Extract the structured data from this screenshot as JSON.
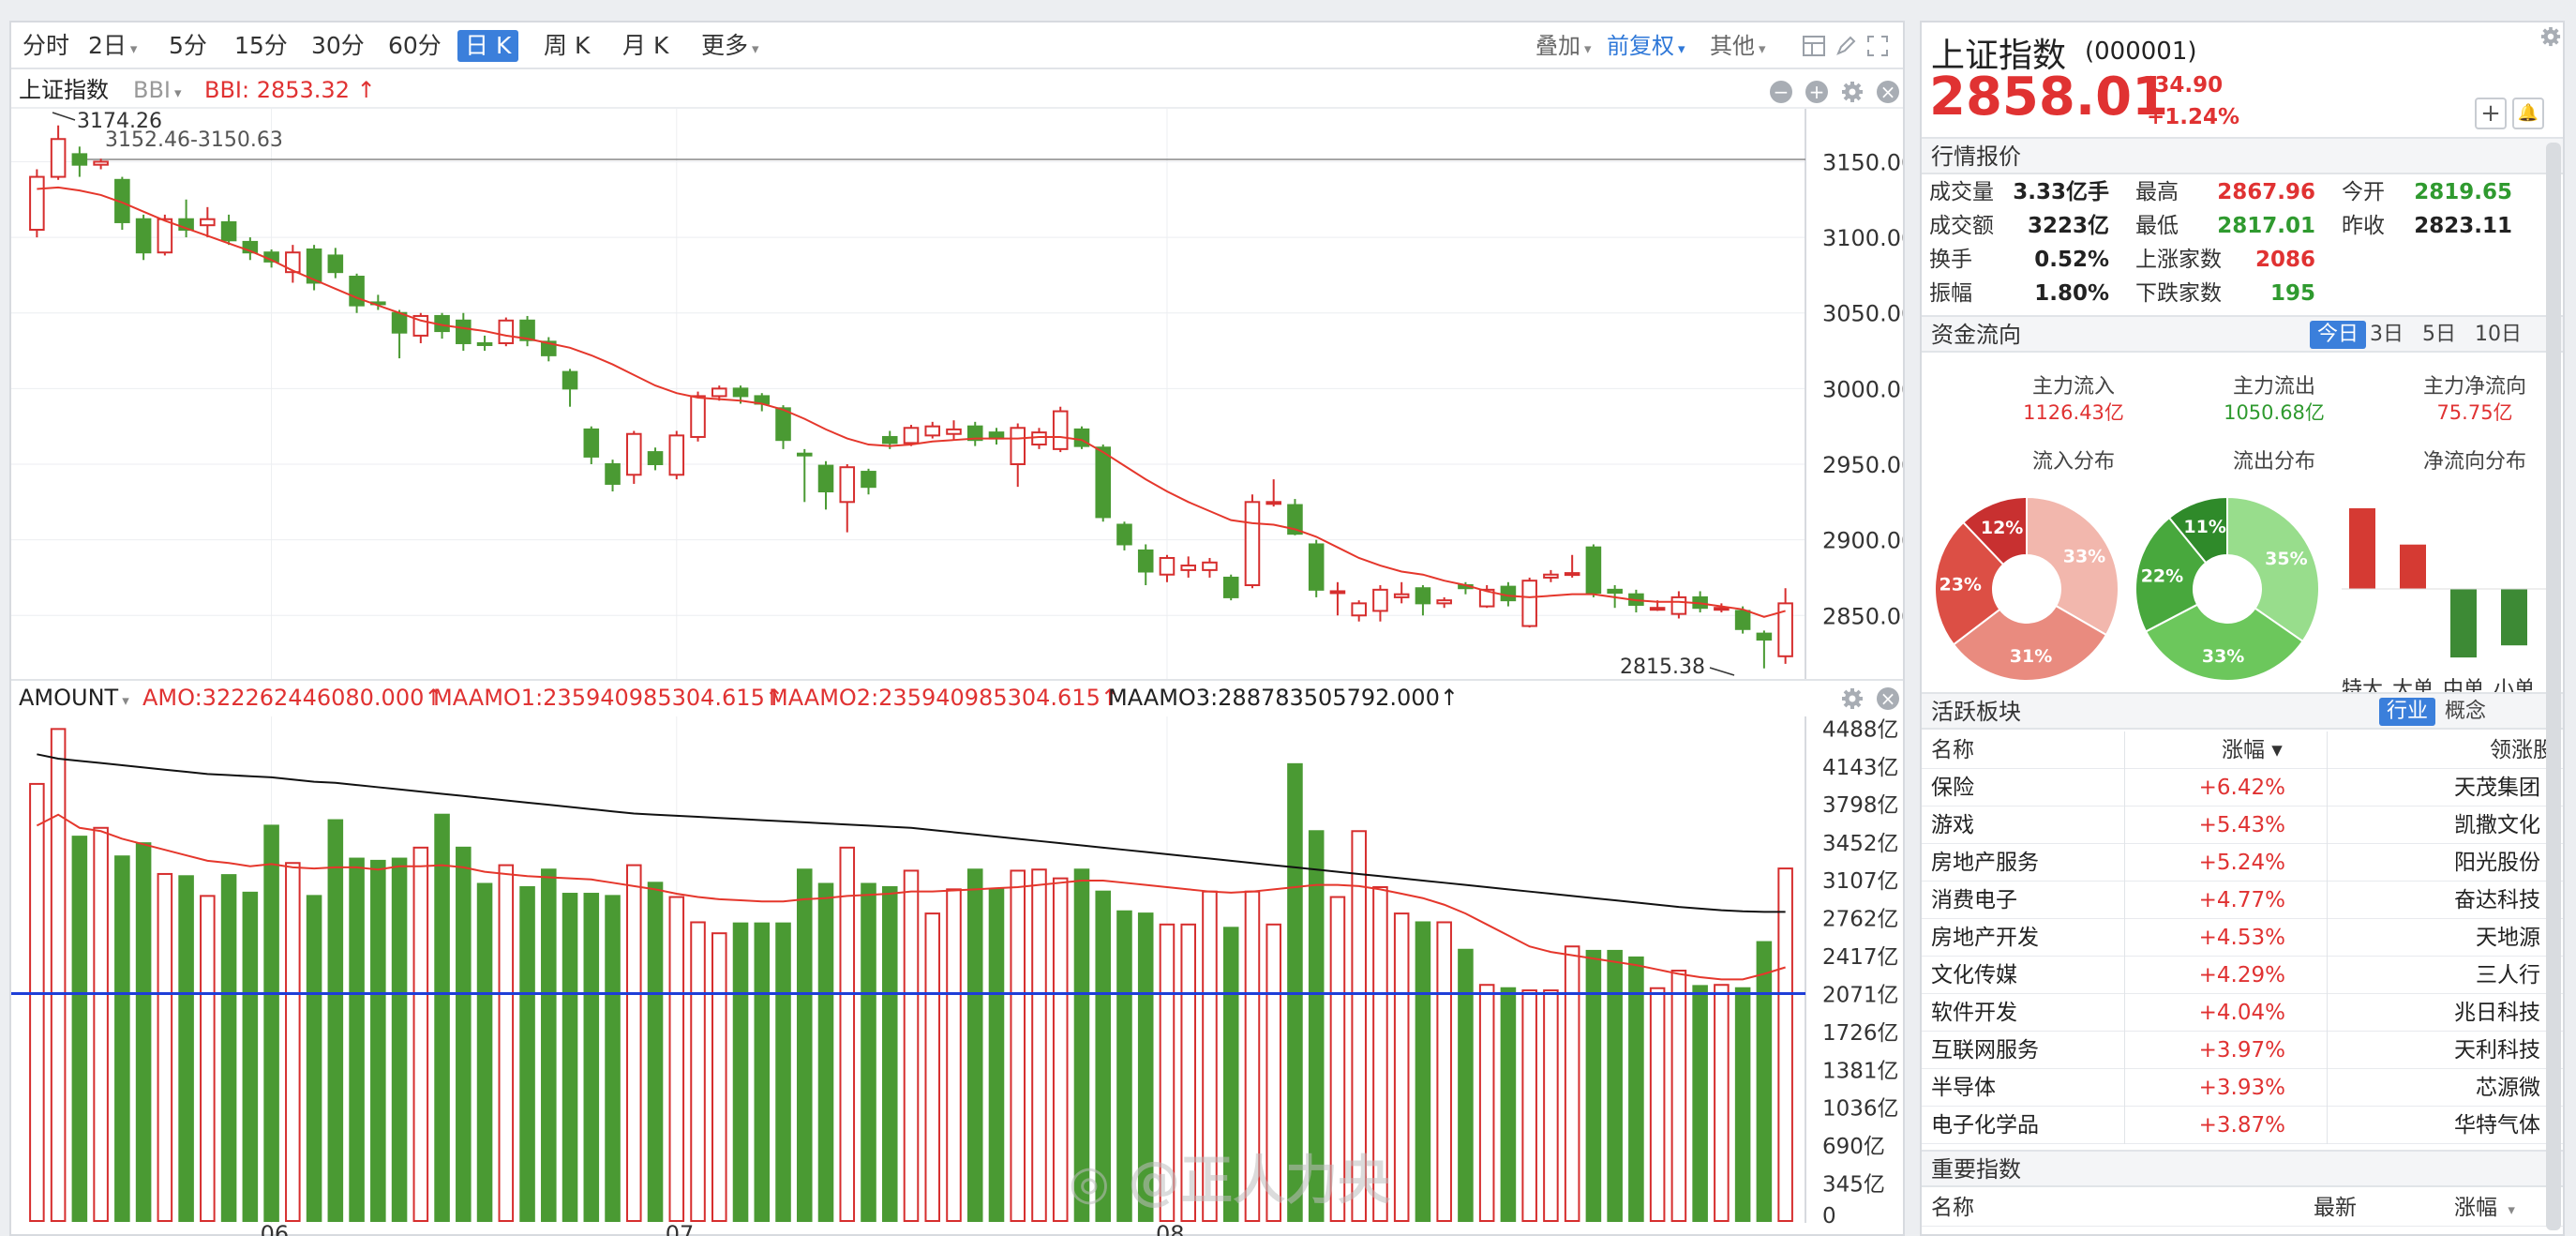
{
  "period_tabs": [
    {
      "label": "分时",
      "active": false,
      "caret": false
    },
    {
      "label": "2日",
      "active": false,
      "caret": true
    },
    {
      "label": "5分",
      "active": false,
      "caret": false
    },
    {
      "label": "15分",
      "active": false,
      "caret": false
    },
    {
      "label": "30分",
      "active": false,
      "caret": false
    },
    {
      "label": "60分",
      "active": false,
      "caret": false
    },
    {
      "label": "日 K",
      "active": true,
      "caret": false
    },
    {
      "label": "周 K",
      "active": false,
      "caret": false
    },
    {
      "label": "月 K",
      "active": false,
      "caret": false
    },
    {
      "label": "更多",
      "active": false,
      "caret": true
    }
  ],
  "toolbar_right": {
    "overlay": "叠加",
    "adjust": "前复权",
    "other": "其他"
  },
  "kline_header": {
    "name": "上证指数",
    "indicator": "BBI",
    "bbi_value": "BBI: 2853.32 ↑"
  },
  "volume_header": {
    "name": "AMOUNT",
    "amo": "AMO:322262446080.000↑",
    "ma1": "MAAMO1:235940985304.615↑",
    "ma2": "MAAMO2:235940985304.615↑",
    "ma3": "MAAMO3:288783505792.000↑"
  },
  "chart_data": {
    "type": "candlestick",
    "price_ylim": [
      2808,
      3185
    ],
    "price_ticks": [
      "3150.00",
      "3100.00",
      "3050.00",
      "3000.00",
      "2950.00",
      "2900.00",
      "2850.00"
    ],
    "price_tick_values": [
      3150,
      3100,
      3050,
      3000,
      2950,
      2900,
      2850
    ],
    "reference_line_value": 3151.5,
    "annotations": {
      "high": "3174.26",
      "range": "3152.46-3150.63",
      "low": "2815.38"
    },
    "x_labels": [
      "06",
      "07",
      "08"
    ],
    "x_label_index": [
      11,
      30,
      53
    ],
    "up_color": "#d62e2e",
    "down_color": "#4a9a33",
    "candles": [
      [
        3105,
        3140,
        3100,
        3145
      ],
      [
        3140,
        3165,
        3138,
        3174
      ],
      [
        3155,
        3148,
        3140,
        3160
      ],
      [
        3148,
        3150,
        3145,
        3152
      ],
      [
        3138,
        3110,
        3105,
        3140
      ],
      [
        3112,
        3090,
        3085,
        3115
      ],
      [
        3090,
        3112,
        3088,
        3115
      ],
      [
        3112,
        3105,
        3100,
        3125
      ],
      [
        3108,
        3112,
        3100,
        3120
      ],
      [
        3110,
        3098,
        3095,
        3115
      ],
      [
        3097,
        3090,
        3085,
        3100
      ],
      [
        3090,
        3084,
        3080,
        3092
      ],
      [
        3077,
        3090,
        3070,
        3095
      ],
      [
        3092,
        3070,
        3065,
        3095
      ],
      [
        3088,
        3077,
        3073,
        3093
      ],
      [
        3074,
        3055,
        3050,
        3076
      ],
      [
        3057,
        3056,
        3052,
        3062
      ],
      [
        3050,
        3037,
        3020,
        3052
      ],
      [
        3035,
        3048,
        3030,
        3050
      ],
      [
        3048,
        3038,
        3033,
        3050
      ],
      [
        3045,
        3030,
        3025,
        3050
      ],
      [
        3030,
        3029,
        3025,
        3035
      ],
      [
        3030,
        3045,
        3028,
        3047
      ],
      [
        3045,
        3032,
        3028,
        3048
      ],
      [
        3031,
        3022,
        3018,
        3034
      ],
      [
        3011,
        3000,
        2988,
        3013
      ],
      [
        2973,
        2955,
        2950,
        2975
      ],
      [
        2950,
        2937,
        2932,
        2953
      ],
      [
        2943,
        2970,
        2937,
        2972
      ],
      [
        2958,
        2950,
        2946,
        2961
      ],
      [
        2943,
        2969,
        2940,
        2972
      ],
      [
        2968,
        2995,
        2965,
        2998
      ],
      [
        2995,
        3000,
        2992,
        3002
      ],
      [
        3000,
        2995,
        2990,
        3002
      ],
      [
        2995,
        2990,
        2985,
        2997
      ],
      [
        2987,
        2966,
        2960,
        2989
      ],
      [
        2957,
        2956,
        2925,
        2960
      ],
      [
        2949,
        2932,
        2920,
        2952
      ],
      [
        2925,
        2948,
        2905,
        2950
      ],
      [
        2945,
        2935,
        2930,
        2947
      ],
      [
        2968,
        2964,
        2960,
        2972
      ],
      [
        2964,
        2974,
        2962,
        2976
      ],
      [
        2969,
        2975,
        2967,
        2978
      ],
      [
        2970,
        2973,
        2966,
        2979
      ],
      [
        2975,
        2966,
        2962,
        2978
      ],
      [
        2971,
        2967,
        2963,
        2974
      ],
      [
        2950,
        2974,
        2935,
        2977
      ],
      [
        2963,
        2971,
        2960,
        2974
      ],
      [
        2960,
        2985,
        2958,
        2988
      ],
      [
        2973,
        2962,
        2960,
        2975
      ],
      [
        2961,
        2915,
        2912,
        2963
      ],
      [
        2910,
        2897,
        2893,
        2912
      ],
      [
        2893,
        2879,
        2870,
        2897
      ],
      [
        2877,
        2888,
        2872,
        2890
      ],
      [
        2880,
        2883,
        2875,
        2889
      ],
      [
        2880,
        2885,
        2875,
        2888
      ],
      [
        2875,
        2862,
        2860,
        2877
      ],
      [
        2870,
        2925,
        2868,
        2930
      ],
      [
        2924,
        2925,
        2922,
        2940
      ],
      [
        2923,
        2904,
        2903,
        2927
      ],
      [
        2897,
        2867,
        2862,
        2900
      ],
      [
        2866,
        2866,
        2850,
        2872
      ],
      [
        2850,
        2858,
        2846,
        2860
      ],
      [
        2853,
        2867,
        2846,
        2870
      ],
      [
        2862,
        2864,
        2858,
        2872
      ],
      [
        2868,
        2858,
        2850,
        2870
      ],
      [
        2858,
        2860,
        2855,
        2862
      ],
      [
        2870,
        2868,
        2864,
        2872
      ],
      [
        2856,
        2867,
        2855,
        2870
      ],
      [
        2869,
        2860,
        2856,
        2872
      ],
      [
        2843,
        2873,
        2842,
        2875
      ],
      [
        2875,
        2877,
        2872,
        2880
      ],
      [
        2878,
        2878,
        2875,
        2890
      ],
      [
        2895,
        2865,
        2862,
        2897
      ],
      [
        2867,
        2865,
        2855,
        2870
      ],
      [
        2864,
        2857,
        2852,
        2867
      ],
      [
        2855,
        2855,
        2853,
        2860
      ],
      [
        2851,
        2862,
        2848,
        2866
      ],
      [
        2862,
        2855,
        2852,
        2866
      ],
      [
        2854,
        2855,
        2852,
        2858
      ],
      [
        2853,
        2841,
        2838,
        2856
      ],
      [
        2838,
        2834,
        2815,
        2840
      ],
      [
        2823,
        2858,
        2818,
        2868
      ]
    ],
    "ma_line": [
      3132,
      3133,
      3131,
      3128,
      3123,
      3117,
      3111,
      3106,
      3101,
      3096,
      3091,
      3085,
      3078,
      3072,
      3066,
      3060,
      3055,
      3050,
      3045,
      3042,
      3040,
      3038,
      3035,
      3033,
      3030,
      3027,
      3022,
      3016,
      3009,
      3002,
      2997,
      2994,
      2993,
      2992,
      2990,
      2986,
      2980,
      2973,
      2967,
      2963,
      2962,
      2963,
      2965,
      2966,
      2967,
      2967,
      2967,
      2968,
      2968,
      2966,
      2958,
      2949,
      2940,
      2932,
      2925,
      2919,
      2913,
      2911,
      2910,
      2907,
      2902,
      2895,
      2888,
      2883,
      2879,
      2877,
      2873,
      2870,
      2866,
      2863,
      2862,
      2863,
      2864,
      2864,
      2862,
      2860,
      2859,
      2859,
      2858,
      2856,
      2854,
      2849,
      2853
    ],
    "amount_ylim": [
      0,
      4560
    ],
    "amount_ticks": [
      "4488亿",
      "4143亿",
      "3798亿",
      "3452亿",
      "3107亿",
      "2762亿",
      "2417亿",
      "2071亿",
      "1726亿",
      "1381亿",
      "1036亿",
      "690亿",
      "345亿",
      "0"
    ],
    "amount_tick_values": [
      4488,
      4143,
      3798,
      3452,
      3107,
      2762,
      2417,
      2071,
      1726,
      1381,
      1036,
      690,
      345,
      0
    ],
    "amount_baseline": 2071,
    "amounts": [
      3980,
      4480,
      3500,
      3580,
      3320,
      3440,
      3160,
      3140,
      2960,
      3150,
      2990,
      3600,
      3260,
      2960,
      3650,
      3300,
      3280,
      3300,
      3400,
      3700,
      3400,
      3070,
      3240,
      3040,
      3200,
      2980,
      2980,
      2960,
      3240,
      3080,
      2950,
      2720,
      2620,
      2710,
      2710,
      2710,
      3200,
      3070,
      3400,
      3070,
      3040,
      3190,
      2800,
      3020,
      3200,
      3020,
      3190,
      3200,
      3120,
      3200,
      3000,
      2820,
      2800,
      2700,
      2700,
      3000,
      2670,
      3000,
      2700,
      4160,
      3550,
      2950,
      3550,
      3040,
      2800,
      2720,
      2720,
      2470,
      2150,
      2120,
      2100,
      2100,
      2500,
      2460,
      2460,
      2400,
      2120,
      2280,
      2140,
      2150,
      2120,
      2540,
      3210
    ],
    "amount_ma1": [
      3600,
      3700,
      3580,
      3550,
      3480,
      3430,
      3380,
      3330,
      3280,
      3260,
      3230,
      3250,
      3220,
      3210,
      3220,
      3220,
      3200,
      3230,
      3230,
      3240,
      3220,
      3180,
      3160,
      3140,
      3130,
      3120,
      3110,
      3080,
      3050,
      3020,
      2980,
      2950,
      2930,
      2920,
      2910,
      2910,
      2930,
      2940,
      2960,
      2970,
      2980,
      3000,
      3000,
      3010,
      3020,
      3030,
      3040,
      3060,
      3080,
      3100,
      3100,
      3080,
      3060,
      3040,
      3020,
      3000,
      2990,
      3000,
      3020,
      3040,
      3060,
      3060,
      3050,
      3020,
      2980,
      2940,
      2880,
      2800,
      2700,
      2600,
      2500,
      2450,
      2420,
      2390,
      2360,
      2330,
      2290,
      2250,
      2220,
      2200,
      2200,
      2250,
      2310
    ],
    "amount_ma3": [
      4250,
      4210,
      4190,
      4170,
      4150,
      4130,
      4110,
      4090,
      4070,
      4060,
      4050,
      4040,
      4020,
      4000,
      3990,
      3970,
      3950,
      3930,
      3910,
      3890,
      3870,
      3850,
      3830,
      3810,
      3790,
      3770,
      3750,
      3730,
      3710,
      3700,
      3690,
      3680,
      3670,
      3660,
      3650,
      3640,
      3630,
      3620,
      3610,
      3600,
      3590,
      3580,
      3560,
      3540,
      3520,
      3500,
      3480,
      3460,
      3440,
      3420,
      3400,
      3380,
      3360,
      3340,
      3320,
      3300,
      3280,
      3260,
      3240,
      3220,
      3200,
      3180,
      3160,
      3140,
      3120,
      3100,
      3080,
      3060,
      3040,
      3020,
      3000,
      2980,
      2960,
      2940,
      2920,
      2900,
      2880,
      2860,
      2845,
      2830,
      2820,
      2815,
      2815
    ]
  },
  "quote": {
    "name": "上证指数",
    "code": "(000001)",
    "price": "2858.01",
    "change": "34.90",
    "change_pct": "+1.24%"
  },
  "market": {
    "title": "行情报价",
    "rows": [
      [
        {
          "label": "成交量",
          "value": "3.33亿手",
          "color": "blk"
        },
        {
          "label": "最高",
          "value": "2867.96",
          "color": "red"
        },
        {
          "label": "今开",
          "value": "2819.65",
          "color": "green"
        }
      ],
      [
        {
          "label": "成交额",
          "value": "3223亿",
          "color": "blk"
        },
        {
          "label": "最低",
          "value": "2817.01",
          "color": "green"
        },
        {
          "label": "昨收",
          "value": "2823.11",
          "color": "blk"
        }
      ],
      [
        {
          "label": "换手",
          "value": "0.52%",
          "color": "blk"
        },
        {
          "label": "上涨家数",
          "value": "2086",
          "color": "red"
        }
      ],
      [
        {
          "label": "振幅",
          "value": "1.80%",
          "color": "blk"
        },
        {
          "label": "下跌家数",
          "value": "195",
          "color": "green"
        }
      ]
    ]
  },
  "fund_flow": {
    "title": "资金流向",
    "tabs": [
      {
        "label": "今日",
        "active": true
      },
      {
        "label": "3日",
        "active": false
      },
      {
        "label": "5日",
        "active": false
      },
      {
        "label": "10日",
        "active": false
      }
    ],
    "inflow_label": "主力流入",
    "inflow_value": "1126.43亿",
    "outflow_label": "主力流出",
    "outflow_value": "1050.68亿",
    "net_label": "主力净流向",
    "net_value": "75.75亿",
    "pie_in_title": "流入分布",
    "pie_out_title": "流出分布",
    "net_dist_title": "净流向分布",
    "pie_in": [
      {
        "label": "33%",
        "value": 33,
        "color": "#f2b7ad"
      },
      {
        "label": "31%",
        "value": 31,
        "color": "#e98b7f"
      },
      {
        "label": "23%",
        "value": 23,
        "color": "#dc4f45"
      },
      {
        "label": "12%",
        "value": 12,
        "color": "#c83030"
      }
    ],
    "pie_out": [
      {
        "label": "35%",
        "value": 35,
        "color": "#98dd8c"
      },
      {
        "label": "33%",
        "value": 33,
        "color": "#6cc75c"
      },
      {
        "label": "22%",
        "value": 22,
        "color": "#48a83d"
      },
      {
        "label": "11%",
        "value": 11,
        "color": "#2f8a2a"
      }
    ],
    "net_bars": [
      {
        "label": "特大",
        "value": 1.0
      },
      {
        "label": "大单",
        "value": 0.55
      },
      {
        "label": "中单",
        "value": -0.85
      },
      {
        "label": "小单",
        "value": -0.7
      }
    ]
  },
  "sectors": {
    "title": "活跃板块",
    "tabs": [
      {
        "label": "行业",
        "active": true
      },
      {
        "label": "概念",
        "active": false
      }
    ],
    "headers": [
      "名称",
      "涨幅",
      "领涨股"
    ],
    "rows": [
      [
        "保险",
        "+6.42%",
        "天茂集团"
      ],
      [
        "游戏",
        "+5.43%",
        "凯撒文化"
      ],
      [
        "房地产服务",
        "+5.24%",
        "阳光股份"
      ],
      [
        "消费电子",
        "+4.77%",
        "奋达科技"
      ],
      [
        "房地产开发",
        "+4.53%",
        "天地源"
      ],
      [
        "文化传媒",
        "+4.29%",
        "三人行"
      ],
      [
        "软件开发",
        "+4.04%",
        "兆日科技"
      ],
      [
        "互联网服务",
        "+3.97%",
        "天利科技"
      ],
      [
        "半导体",
        "+3.93%",
        "芯源微"
      ],
      [
        "电子化学品",
        "+3.87%",
        "华特气体"
      ]
    ]
  },
  "indices": {
    "title": "重要指数",
    "headers": [
      "名称",
      "最新",
      "涨幅"
    ]
  },
  "watermark": "@正人力央"
}
